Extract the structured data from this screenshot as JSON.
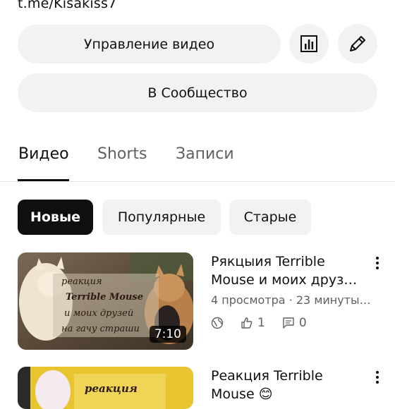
{
  "channel": {
    "link": "t.me/Kisakiss7"
  },
  "actions": {
    "manage_videos": "Управление видео",
    "community": "В Сообщество",
    "analytics_icon": "bar-chart-icon",
    "edit_icon": "pencil-icon"
  },
  "tabs": [
    {
      "label": "Видео",
      "active": true
    },
    {
      "label": "Shorts",
      "active": false
    },
    {
      "label": "Записи",
      "active": false
    }
  ],
  "filters": [
    {
      "label": "Новые",
      "selected": true
    },
    {
      "label": "Популярные",
      "selected": false
    },
    {
      "label": "Старые",
      "selected": false
    }
  ],
  "videos": [
    {
      "title_line1": "Рякцыия Terrible",
      "title_line2": "Mouse и моих друз…",
      "meta": "4 просмотра · 23 минуты…",
      "duration": "7:10",
      "likes": "1",
      "comments": "0",
      "thumb_text": [
        "реакция",
        "Terrible Mouse",
        "и моих друзей",
        "на гачу страши"
      ]
    },
    {
      "title_line1": "Реакция Terrible",
      "title_line2": "Mouse 😊",
      "thumb_text": [
        "реакция"
      ]
    }
  ],
  "colors": {
    "pill_bg": "#f2f2f2",
    "chip_selected_bg": "#0f0f0f",
    "secondary_text": "#606060"
  }
}
